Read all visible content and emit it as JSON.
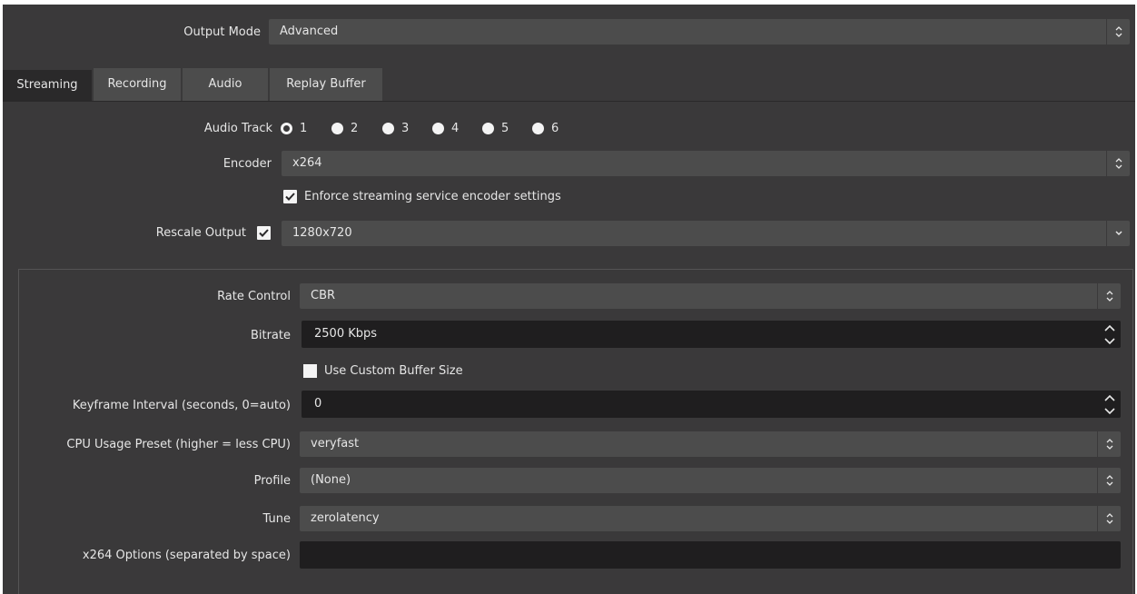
{
  "output_mode": {
    "label": "Output Mode",
    "value": "Advanced"
  },
  "tabs": [
    {
      "label": "Streaming",
      "active": true
    },
    {
      "label": "Recording",
      "active": false
    },
    {
      "label": "Audio",
      "active": false
    },
    {
      "label": "Replay Buffer",
      "active": false
    }
  ],
  "audio_track": {
    "label": "Audio Track",
    "options": [
      "1",
      "2",
      "3",
      "4",
      "5",
      "6"
    ],
    "selected": "1"
  },
  "encoder": {
    "label": "Encoder",
    "value": "x264"
  },
  "enforce": {
    "label": "Enforce streaming service encoder settings",
    "checked": true
  },
  "rescale": {
    "label": "Rescale Output",
    "checked": true,
    "value": "1280x720"
  },
  "rate_control": {
    "label": "Rate Control",
    "value": "CBR"
  },
  "bitrate": {
    "label": "Bitrate",
    "value": "2500 Kbps"
  },
  "custom_buffer": {
    "label": "Use Custom Buffer Size",
    "checked": false
  },
  "keyframe": {
    "label": "Keyframe Interval (seconds, 0=auto)",
    "value": "0"
  },
  "cpu_preset": {
    "label": "CPU Usage Preset (higher = less CPU)",
    "value": "veryfast"
  },
  "profile": {
    "label": "Profile",
    "value": "(None)"
  },
  "tune": {
    "label": "Tune",
    "value": "zerolatency"
  },
  "x264_options": {
    "label": "x264 Options (separated by space)",
    "value": ""
  },
  "icons": {
    "combo_arrow": "up-down-chevron-icon",
    "dropdown_arrow": "chevron-down-icon",
    "spin_up": "spin-up-icon",
    "spin_down": "spin-down-icon",
    "checkmark": "checkmark-icon"
  },
  "colors": {
    "panel": "#3a393a",
    "field": "#4c4c4c",
    "input": "#1f1e1f",
    "text": "#e6e6e6"
  }
}
